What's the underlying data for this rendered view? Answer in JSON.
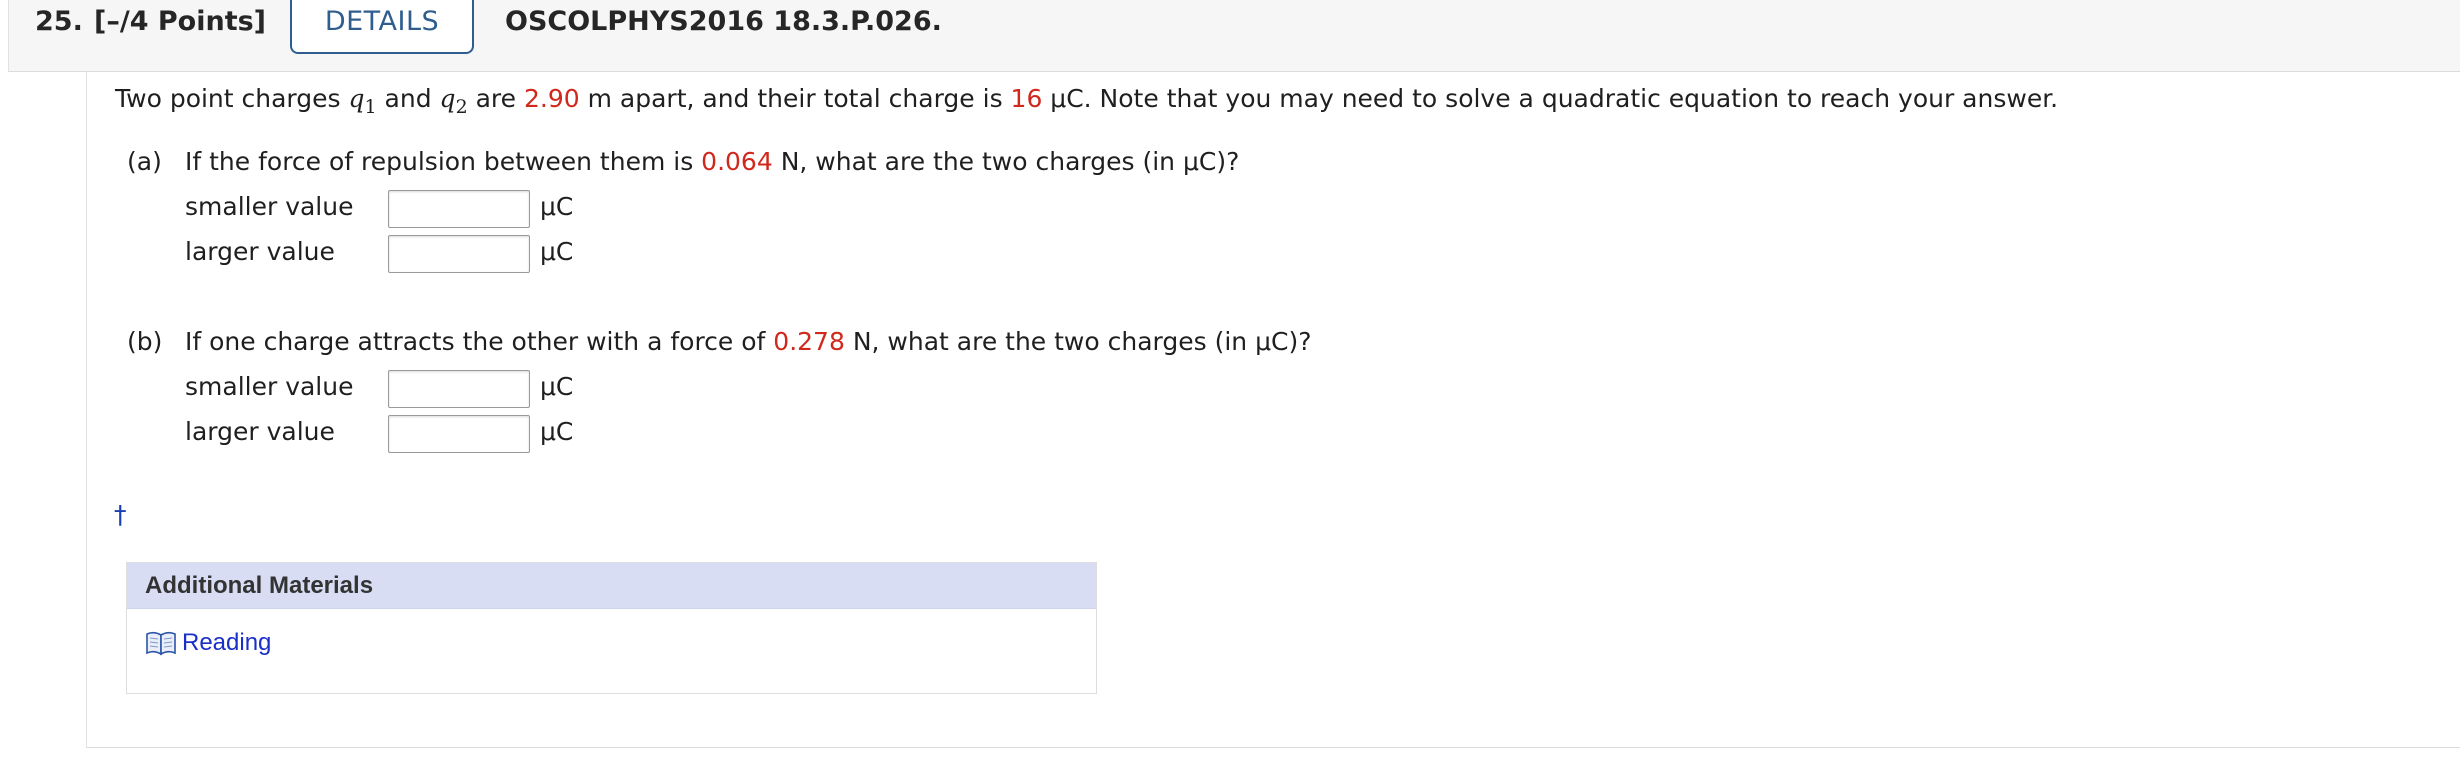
{
  "header": {
    "question_number": "25.",
    "points": "[–/4 Points]",
    "details_label": "DETAILS",
    "question_code": "OSCOLPHYS2016 18.3.P.026."
  },
  "intro": {
    "t1": "Two point charges ",
    "q1_var": "q",
    "q1_sub": "1",
    "t2": " and ",
    "q2_var": "q",
    "q2_sub": "2",
    "t3": " are ",
    "distance": "2.90",
    "t4": " m apart, and their total charge is ",
    "total_charge": "16",
    "t5": " μC. Note that you may need to solve a quadratic equation to reach your answer."
  },
  "part_a": {
    "label": "(a)",
    "q_pre": "If the force of repulsion between them is ",
    "force": "0.064",
    "q_post": " N, what are the two charges (in μC)?",
    "rows": [
      {
        "label": "smaller value",
        "value": "",
        "unit": "μC"
      },
      {
        "label": "larger value",
        "value": "",
        "unit": "μC"
      }
    ]
  },
  "part_b": {
    "label": "(b)",
    "q_pre": "If one charge attracts the other with a force of ",
    "force": "0.278",
    "q_post": " N, what are the two charges (in μC)?",
    "rows": [
      {
        "label": "smaller value",
        "value": "",
        "unit": "μC"
      },
      {
        "label": "larger value",
        "value": "",
        "unit": "μC"
      }
    ]
  },
  "footnote_symbol": "†",
  "materials": {
    "title": "Additional Materials",
    "items": [
      {
        "label": "Reading",
        "icon": "book-icon"
      }
    ]
  },
  "colors": {
    "highlight_red": "#d0281c",
    "details_blue": "#2f5e8e",
    "link_blue": "#1a2fc8",
    "materials_header_bg": "#d9ddf3"
  }
}
